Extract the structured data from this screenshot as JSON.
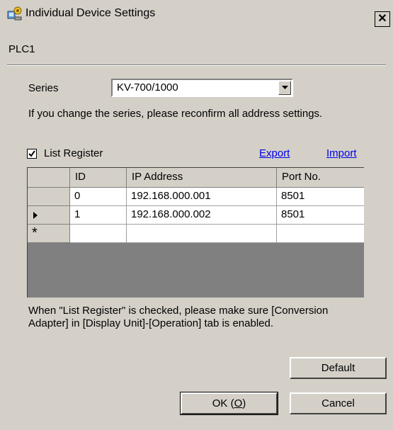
{
  "window": {
    "title": "Individual Device Settings",
    "close_glyph": "✕"
  },
  "device": {
    "name": "PLC1"
  },
  "series": {
    "label": "Series",
    "value": "KV-700/1000"
  },
  "notice": "If you change the series, please reconfirm all address settings.",
  "list_register": {
    "label": "List Register",
    "checked": true
  },
  "links": {
    "export": "Export",
    "import": "Import"
  },
  "table": {
    "columns": [
      "ID",
      "IP Address",
      "Port No."
    ],
    "rows": [
      {
        "id": "0",
        "ip": "192.168.000.001",
        "port": "8501"
      },
      {
        "id": "1",
        "ip": "192.168.000.002",
        "port": "8501"
      }
    ],
    "new_row_marker": "*"
  },
  "bottom_note": "When \"List Register\" is checked, please make sure [Conversion Adapter] in [Display Unit]-[Operation] tab is enabled.",
  "buttons": {
    "default": "Default",
    "ok": "OK (O)",
    "cancel": "Cancel"
  },
  "icons": {
    "app": "device-settings-icon",
    "close": "close-icon",
    "dropdown": "chevron-down-icon",
    "row_pointer": "row-pointer-icon"
  },
  "colors": {
    "window_bg": "#d4d0c8",
    "link": "#0000ee",
    "grid_empty": "#808080"
  }
}
